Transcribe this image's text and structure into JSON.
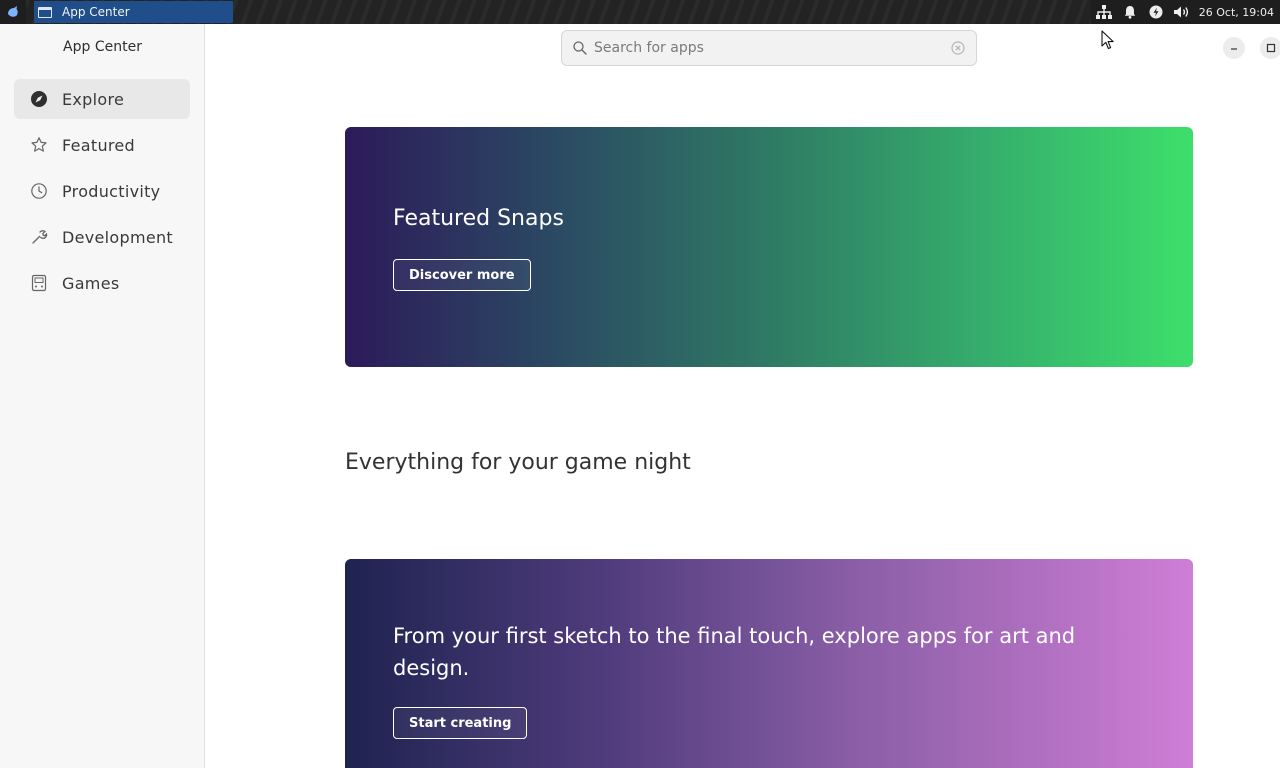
{
  "panel": {
    "task_title": "App Center",
    "clock": "26 Oct, 19:04"
  },
  "sidebar": {
    "title": "App Center",
    "items": [
      {
        "label": "Explore",
        "icon": "compass-icon",
        "active": true
      },
      {
        "label": "Featured",
        "icon": "star-icon",
        "active": false
      },
      {
        "label": "Productivity",
        "icon": "clock-icon",
        "active": false
      },
      {
        "label": "Development",
        "icon": "wrench-icon",
        "active": false
      },
      {
        "label": "Games",
        "icon": "gamepad-icon",
        "active": false
      }
    ]
  },
  "search": {
    "placeholder": "Search for apps",
    "value": ""
  },
  "banners": {
    "featured": {
      "title": "Featured Snaps",
      "button": "Discover more"
    },
    "creative": {
      "title": "From your first sketch to the final touch, explore apps for art and design.",
      "button": "Start creating"
    }
  },
  "sections": {
    "games_title": "Everything for your game night"
  },
  "colors": {
    "accent_green": "#3ddf6b",
    "accent_purple": "#cf7ed6",
    "task_button": "#1f4e8a"
  }
}
